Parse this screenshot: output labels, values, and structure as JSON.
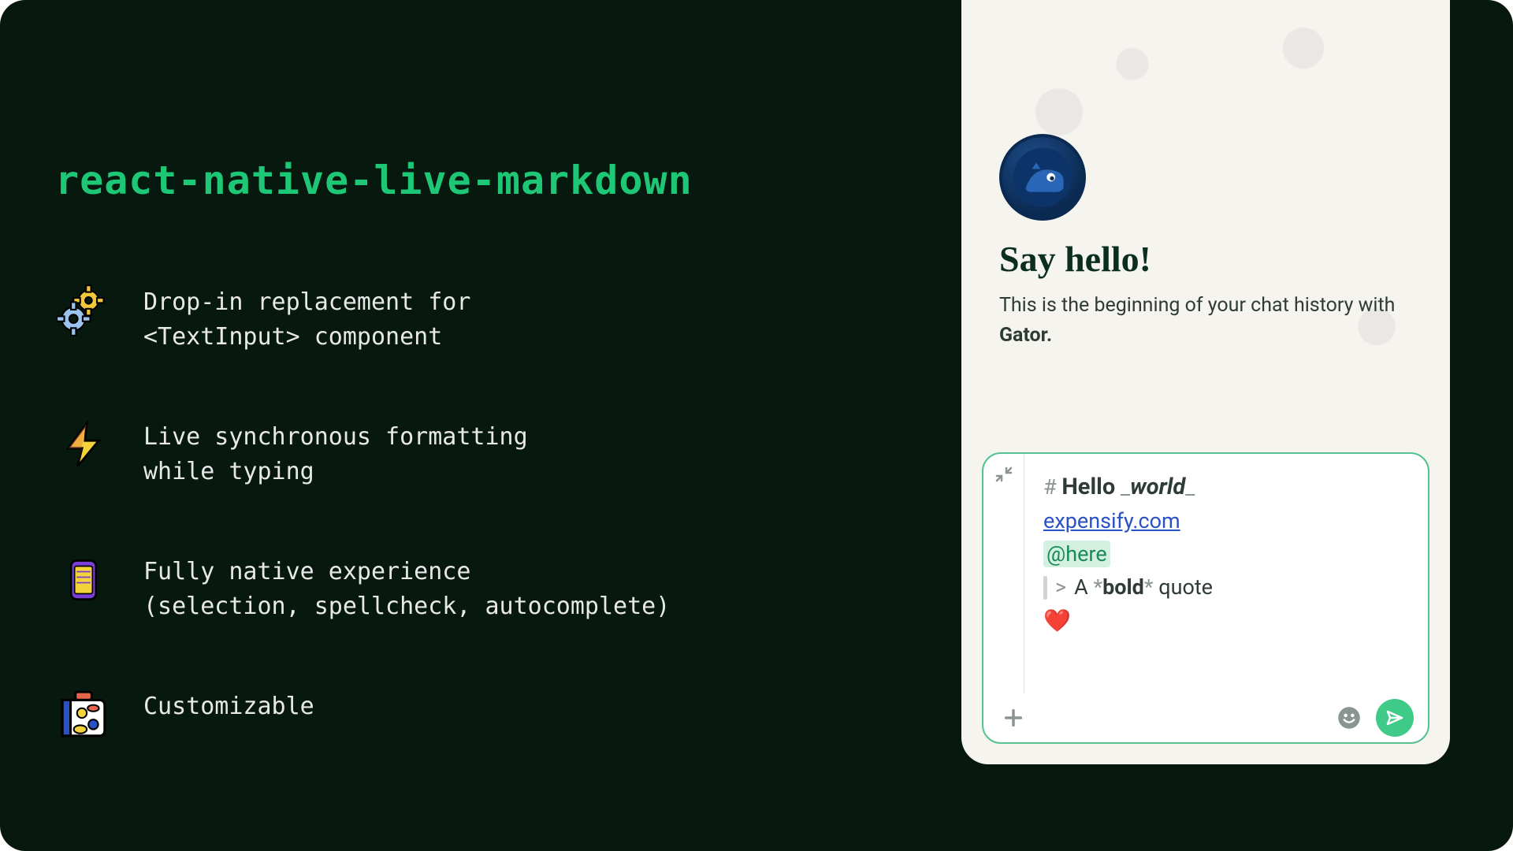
{
  "title": "react-native-live-markdown",
  "features": [
    {
      "icon": "gears-icon",
      "text": "Drop-in replacement for\n<TextInput> component"
    },
    {
      "icon": "lightning-icon",
      "text": "Live synchronous formatting\nwhile typing"
    },
    {
      "icon": "phone-icon",
      "text": "Fully native experience\n(selection, spellcheck, autocomplete)"
    },
    {
      "icon": "suitcase-icon",
      "text": "Customizable"
    }
  ],
  "chat": {
    "say_hello": "Say hello!",
    "sub_prefix": "This is the beginning of your chat history with ",
    "sub_bold": "Gator."
  },
  "composer": {
    "line1_hash": "#",
    "line1_hello": "Hello",
    "line1_under": "_",
    "line1_world": "world",
    "line2_link": "expensify.com",
    "line3_mention": "@here",
    "line4_gt": ">",
    "line4_a": "A",
    "line4_star": "*",
    "line4_bold": "bold",
    "line4_quote": "quote",
    "line5_heart": "❤️"
  },
  "colors": {
    "accent": "#1ec776",
    "bg": "#07190f",
    "phone_bg": "#f6f4ef",
    "link": "#2a52c7",
    "mention_fg": "#1a8a5d",
    "mention_bg": "#d3f0e1",
    "send": "#3fca88"
  }
}
